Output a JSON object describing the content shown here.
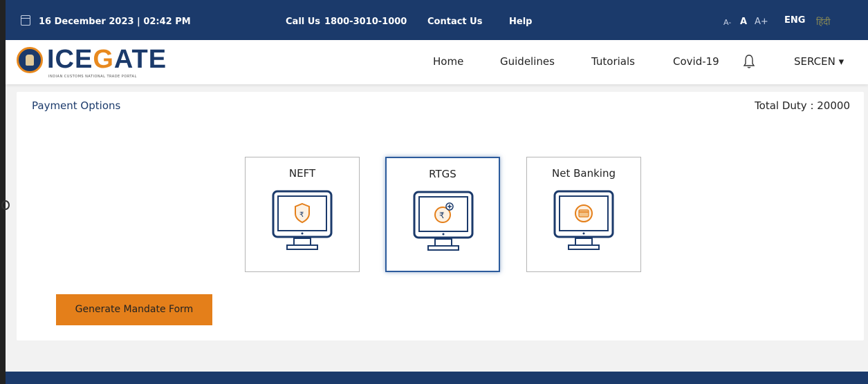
{
  "topbar": {
    "datetime": "16 December 2023 | 02:42 PM",
    "call_label": "Call Us",
    "call_number": "1800-3010-1000",
    "contact": "Contact Us",
    "help": "Help",
    "font_small": "A-",
    "font_normal": "A",
    "font_large": "A+",
    "lang_eng": "ENG",
    "lang_hindi": "हिंदी"
  },
  "logo": {
    "text": "ICEGATE",
    "subtitle": "INDIAN CUSTOMS NATIONAL TRADE PORTAL"
  },
  "nav": {
    "home": "Home",
    "guidelines": "Guidelines",
    "tutorials": "Tutorials",
    "covid": "Covid-19",
    "user": "SERCEN ▾"
  },
  "content": {
    "title": "Payment Options",
    "total_duty": "Total Duty : 20000",
    "options": [
      {
        "label": "NEFT",
        "icon": "shield-rupee-monitor-icon",
        "selected": false
      },
      {
        "label": "RTGS",
        "icon": "rupee-coin-monitor-icon",
        "selected": true
      },
      {
        "label": "Net Banking",
        "icon": "card-monitor-icon",
        "selected": false
      }
    ],
    "generate_button": "Generate Mandate Form"
  },
  "colors": {
    "primary": "#1b3a6b",
    "accent": "#e47f1a"
  }
}
